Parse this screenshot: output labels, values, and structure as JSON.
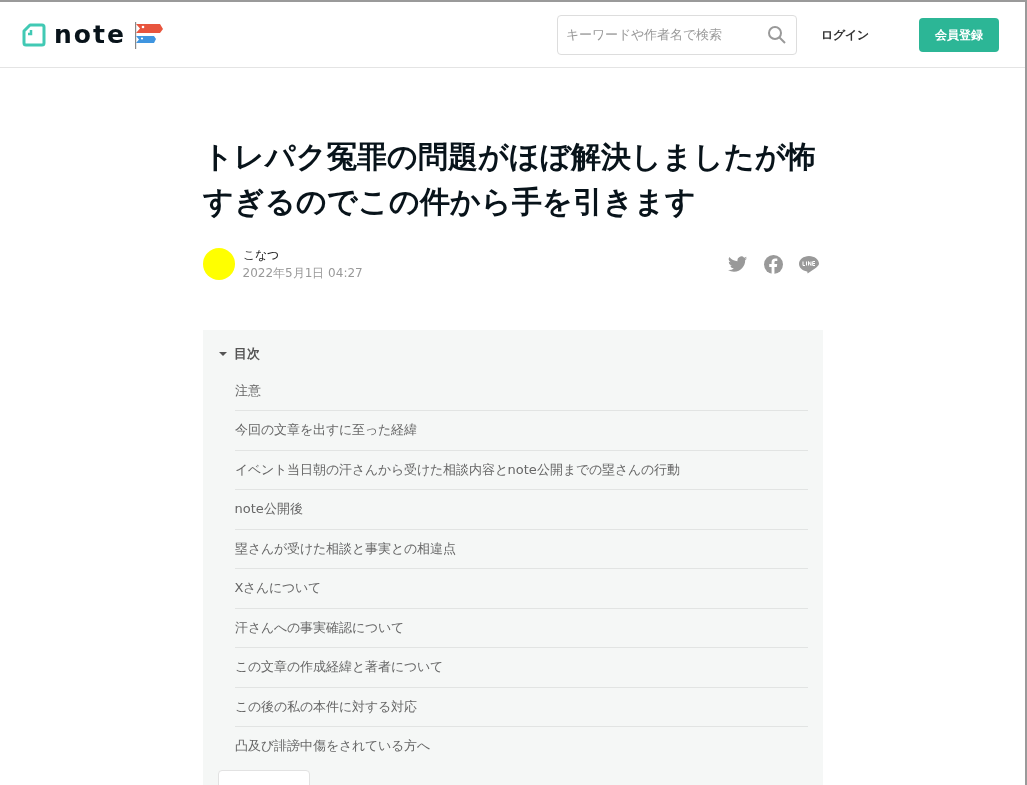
{
  "header": {
    "logo": "note",
    "search": {
      "placeholder": "キーワードや作者名で検索"
    },
    "login": "ログイン",
    "signup": "会員登録"
  },
  "article": {
    "title": "トレパク冤罪の問題がほぼ解決しましたが怖すぎるのでこの件から手を引きます",
    "author": {
      "name": "こなつ"
    },
    "date": "2022年5月1日 04:27"
  },
  "toc": {
    "heading": "目次",
    "expanded": true,
    "items": [
      {
        "label": "注意"
      },
      {
        "label": "今回の文章を出すに至った経緯"
      },
      {
        "label": "イベント当日朝の汗さんから受けた相談内容とnote公開までの塁さんの行動"
      },
      {
        "label": "note公開後"
      },
      {
        "label": "塁さんが受けた相談と事実との相違点"
      },
      {
        "label": "Xさんについて"
      },
      {
        "label": "汗さんへの事実確認について"
      },
      {
        "label": "この文章の作成経緯と著者について"
      },
      {
        "label": "この後の私の本件に対する対応"
      },
      {
        "label": "凸及び誹謗中傷をされている方へ"
      }
    ]
  }
}
